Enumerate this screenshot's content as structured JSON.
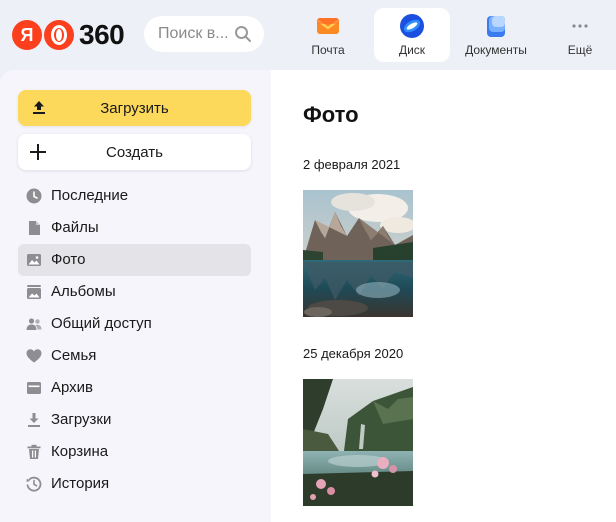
{
  "header": {
    "logo_letter": "Я",
    "logo_number": "360",
    "search_placeholder": "Поиск в...",
    "apps": [
      {
        "label": "Почта",
        "icon": "mail-envelope-icon"
      },
      {
        "label": "Диск",
        "icon": "disk-icon",
        "active": true
      },
      {
        "label": "Документы",
        "icon": "documents-icon"
      },
      {
        "label": "Ещё",
        "icon": "more-dots-icon"
      }
    ]
  },
  "sidebar": {
    "upload_label": "Загрузить",
    "create_label": "Создать",
    "items": [
      {
        "label": "Последние",
        "icon": "clock-icon"
      },
      {
        "label": "Файлы",
        "icon": "file-icon"
      },
      {
        "label": "Фото",
        "icon": "photo-icon",
        "active": true
      },
      {
        "label": "Альбомы",
        "icon": "albums-icon"
      },
      {
        "label": "Общий доступ",
        "icon": "shared-users-icon"
      },
      {
        "label": "Семья",
        "icon": "heart-icon"
      },
      {
        "label": "Архив",
        "icon": "archive-icon"
      },
      {
        "label": "Загрузки",
        "icon": "download-icon"
      },
      {
        "label": "Корзина",
        "icon": "trash-icon"
      },
      {
        "label": "История",
        "icon": "history-icon"
      }
    ]
  },
  "main": {
    "title": "Фото",
    "groups": [
      {
        "date": "2 февраля 2021",
        "photo": "mountain-lake-photo"
      },
      {
        "date": "25 декабря 2020",
        "photo": "fjord-flowers-photo"
      }
    ]
  },
  "colors": {
    "accent_yellow": "#fcd95a",
    "brand_red": "#fc3f1d",
    "header_bg": "#eef0f8",
    "sidebar_bg": "#f5f5fb",
    "active_item_bg": "#e3e3e8"
  }
}
